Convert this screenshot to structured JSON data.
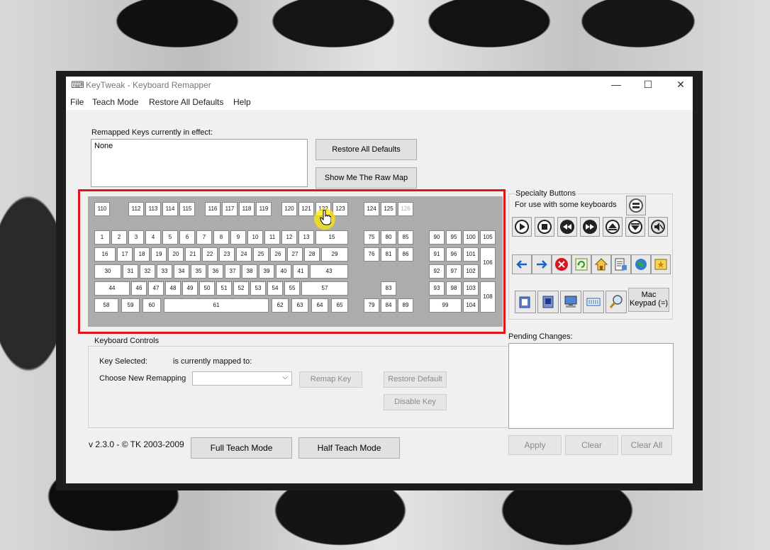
{
  "window": {
    "title": "KeyTweak -  Keyboard Remapper",
    "icon": "keyboard-icon",
    "controls": {
      "minimize": "—",
      "maximize": "☐",
      "close": "✕"
    }
  },
  "menu": [
    "File",
    "Teach Mode",
    "Restore All Defaults",
    "Help"
  ],
  "remapped": {
    "label": "Remapped Keys currently in effect:",
    "value": "None"
  },
  "buttons": {
    "restore_all": "Restore All Defaults",
    "raw_map": "Show Me The Raw Map",
    "remap_key": "Remap Key",
    "restore_default": "Restore Default",
    "disable_key": "Disable Key",
    "full_teach": "Full Teach Mode",
    "half_teach": "Half Teach Mode",
    "apply": "Apply",
    "clear": "Clear",
    "clear_all": "Clear All",
    "mac_keypad": "Mac Keypad (=)"
  },
  "specialty": {
    "title": "Specialty Buttons",
    "subtitle": "For use with some keyboards"
  },
  "keyboard": {
    "fkeys": [
      "110",
      "112",
      "113",
      "114",
      "115",
      "116",
      "117",
      "118",
      "119",
      "120",
      "121",
      "122",
      "123",
      "124",
      "125",
      "126"
    ],
    "row1": [
      "1",
      "2",
      "3",
      "4",
      "5",
      "6",
      "7",
      "8",
      "9",
      "10",
      "11",
      "12",
      "13",
      "15"
    ],
    "row2": [
      "16",
      "17",
      "18",
      "19",
      "20",
      "21",
      "22",
      "23",
      "24",
      "25",
      "26",
      "27",
      "28",
      "29"
    ],
    "row3": [
      "30",
      "31",
      "32",
      "33",
      "34",
      "35",
      "36",
      "37",
      "38",
      "39",
      "40",
      "41",
      "43"
    ],
    "row4": [
      "44",
      "46",
      "47",
      "48",
      "49",
      "50",
      "51",
      "52",
      "53",
      "54",
      "55",
      "57"
    ],
    "row5": [
      "58",
      "59",
      "60",
      "61",
      "62",
      "63",
      "64",
      "65"
    ],
    "nav": [
      "75",
      "80",
      "85",
      "76",
      "81",
      "86",
      "83",
      "79",
      "84",
      "89"
    ],
    "numpad": [
      "90",
      "95",
      "100",
      "105",
      "91",
      "96",
      "101",
      "106",
      "92",
      "97",
      "102",
      "93",
      "98",
      "103",
      "108",
      "99",
      "104"
    ]
  },
  "controls": {
    "group_title": "Keyboard Controls",
    "key_selected": "Key Selected:",
    "mapped_to": "is currently mapped to:",
    "choose_new": "Choose New Remapping",
    "combo_value": ""
  },
  "pending": {
    "label": "Pending Changes:"
  },
  "footer": {
    "version": "v 2.3.0 - © TK 2003-2009"
  }
}
